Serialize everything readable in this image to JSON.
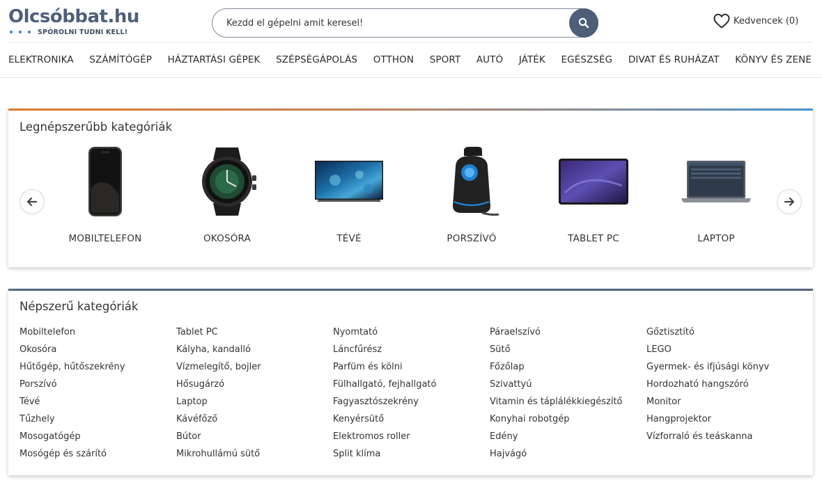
{
  "logo": {
    "title": "Olcsóbbat.hu",
    "slogan": "SPÓROLNI TUDNI KELL!"
  },
  "search": {
    "placeholder": "Kezdd el gépelni amit keresel!",
    "icon": "search-icon"
  },
  "favorites": {
    "label": "Kedvencek (0)",
    "icon": "heart-icon"
  },
  "nav": {
    "items": [
      {
        "label": "ELEKTRONIKA"
      },
      {
        "label": "SZÁMÍTÓGÉP"
      },
      {
        "label": "HÁZTARTÁSI GÉPEK"
      },
      {
        "label": "SZÉPSÉGÁPOLÁS"
      },
      {
        "label": "OTTHON"
      },
      {
        "label": "SPORT"
      },
      {
        "label": "AUTÓ"
      },
      {
        "label": "JÁTÉK"
      },
      {
        "label": "EGÉSZSÉG"
      },
      {
        "label": "DIVAT ÉS RUHÁZAT"
      },
      {
        "label": "KÖNYV ÉS ZENE"
      }
    ]
  },
  "top_categories": {
    "title": "Legnépszerűbb kategóriák",
    "items": [
      {
        "label": "MOBILTELEFON",
        "icon": "smartphone-image"
      },
      {
        "label": "OKOSÓRA",
        "icon": "smartwatch-image"
      },
      {
        "label": "TÉVÉ",
        "icon": "tv-image"
      },
      {
        "label": "PORSZÍVÓ",
        "icon": "vacuum-image"
      },
      {
        "label": "TABLET PC",
        "icon": "tablet-image"
      },
      {
        "label": "LAPTOP",
        "icon": "laptop-image"
      }
    ]
  },
  "popular_categories": {
    "title": "Népszerű kategóriák",
    "columns": [
      [
        "Mobiltelefon",
        "Okosóra",
        "Hűtőgép, hűtőszekrény",
        "Porszívó",
        "Tévé",
        "Tűzhely",
        "Mosogatógép",
        "Mosógép és szárító"
      ],
      [
        "Tablet PC",
        "Kályha, kandalló",
        "Vízmelegítő, bojler",
        "Hősugárzó",
        "Laptop",
        "Kávéfőző",
        "Bútor",
        "Mikrohullámú sütő"
      ],
      [
        "Nyomtató",
        "Láncfűrész",
        "Parfüm és kölni",
        "Fülhallgató, fejhallgató",
        "Fagyasztószekrény",
        "Kenyérsütő",
        "Elektromos roller",
        "Split klíma"
      ],
      [
        "Páraelszívó",
        "Sütő",
        "Főzőlap",
        "Szivattyú",
        "Vitamin és táplálékkiegészítő",
        "Konyhai robotgép",
        "Edény",
        "Hajvágó"
      ],
      [
        "Gőztisztító",
        "LEGO",
        "Gyermek- és ifjúsági könyv",
        "Hordozható hangszóró",
        "Monitor",
        "Hangprojektor",
        "Vízforraló és teáskanna"
      ]
    ]
  },
  "colors": {
    "brand": "#4f5f7a",
    "dot_accent": "#2f84d3",
    "accent_orange": "#e07a2a",
    "accent_blue": "#4a93cc"
  }
}
